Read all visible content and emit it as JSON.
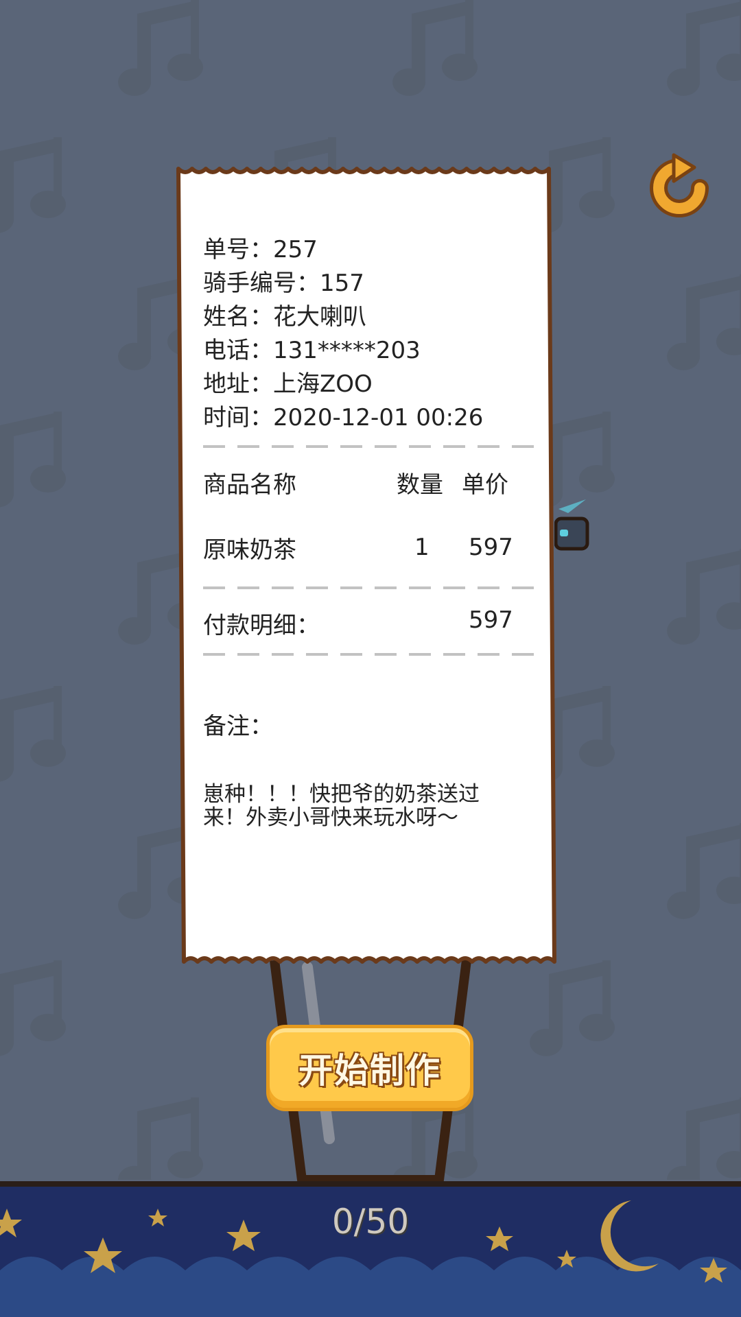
{
  "receipt": {
    "order_no": "单号：257",
    "rider_no": "骑手编号：157",
    "name": "姓名：花大喇叭",
    "phone": "电话：131*****203",
    "address": "地址：上海ZOO",
    "time": "时间：2020-12-01 00:26",
    "col_name": "商品名称",
    "col_qty": "数量",
    "col_price": "单价",
    "items": [
      {
        "name": "原味奶茶",
        "qty": "1",
        "price": "597"
      }
    ],
    "payment_label": "付款明细：",
    "payment_total": "597",
    "remark_label": "备注：",
    "remark_text": "崽种！！！快把爷的奶茶送过来！外卖小哥快来玩水呀～"
  },
  "start_button": {
    "label": "开始制作"
  },
  "progress": {
    "text": "0/50",
    "current": 0,
    "total": 50
  },
  "icons": {
    "refresh": "refresh-icon",
    "background": "music-note-icon",
    "moon": "moon-icon",
    "star": "star-icon"
  },
  "colors": {
    "background": "#5a6578",
    "receipt_border": "#6b3a1a",
    "button": "#ffc94a",
    "bottom_bar": "#1f2d63",
    "star": "#c9a14a"
  }
}
